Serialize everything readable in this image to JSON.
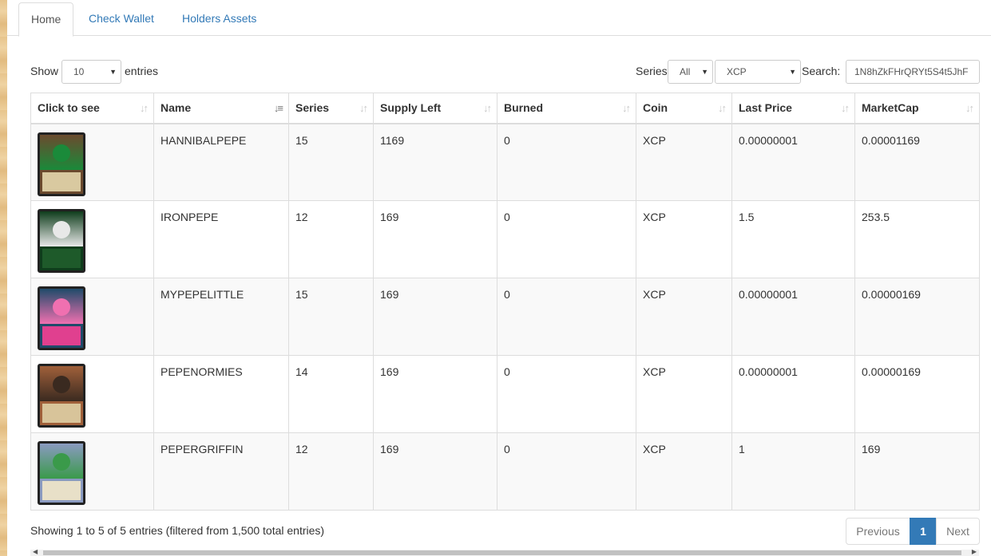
{
  "tabs": [
    {
      "label": "Home"
    },
    {
      "label": "Check Wallet"
    },
    {
      "label": "Holders Assets"
    }
  ],
  "controls": {
    "show_label": "Show",
    "page_size": "10",
    "entries_label": "entries",
    "series_label": "Series",
    "series_value": "All",
    "coin_value": "XCP",
    "search_label": "Search:",
    "search_value": "1N8hZkFHrQRYt5S4t5JhF"
  },
  "table": {
    "columns": [
      "Click to see",
      "Name",
      "Series",
      "Supply Left",
      "Burned",
      "Coin",
      "Last Price",
      "MarketCap"
    ],
    "rows": [
      {
        "name": "HANNIBALPEPE",
        "series": "15",
        "supply_left": "1169",
        "burned": "0",
        "coin": "XCP",
        "last_price": "0.00000001",
        "market_cap": "0.00001169",
        "card_colors": [
          "#6b4a2e",
          "#d9c9a0",
          "#1a8a3a"
        ]
      },
      {
        "name": "IRONPEPE",
        "series": "12",
        "supply_left": "169",
        "burned": "0",
        "coin": "XCP",
        "last_price": "1.5",
        "market_cap": "253.5",
        "card_colors": [
          "#0f3d1c",
          "#1e5a2a",
          "#e8e8e8"
        ]
      },
      {
        "name": "MYPEPELITTLE",
        "series": "15",
        "supply_left": "169",
        "burned": "0",
        "coin": "XCP",
        "last_price": "0.00000001",
        "market_cap": "0.00000169",
        "card_colors": [
          "#1f4b6a",
          "#e0408f",
          "#f070b0"
        ]
      },
      {
        "name": "PEPENORMIES",
        "series": "14",
        "supply_left": "169",
        "burned": "0",
        "coin": "XCP",
        "last_price": "0.00000001",
        "market_cap": "0.00000169",
        "card_colors": [
          "#a0603a",
          "#d8c49a",
          "#3a2a20"
        ]
      },
      {
        "name": "PEPERGRIFFIN",
        "series": "12",
        "supply_left": "169",
        "burned": "0",
        "coin": "XCP",
        "last_price": "1",
        "market_cap": "169",
        "card_colors": [
          "#8a9ac0",
          "#e8e0c8",
          "#3a9a4a"
        ]
      }
    ]
  },
  "footer": {
    "info": "Showing 1 to 5 of 5 entries (filtered from 1,500 total entries)",
    "previous": "Previous",
    "current_page": "1",
    "next": "Next"
  },
  "colors": {
    "link": "#337ab7",
    "border": "#ddd",
    "stripe": "#f9f9f9",
    "active_page": "#337ab7"
  }
}
